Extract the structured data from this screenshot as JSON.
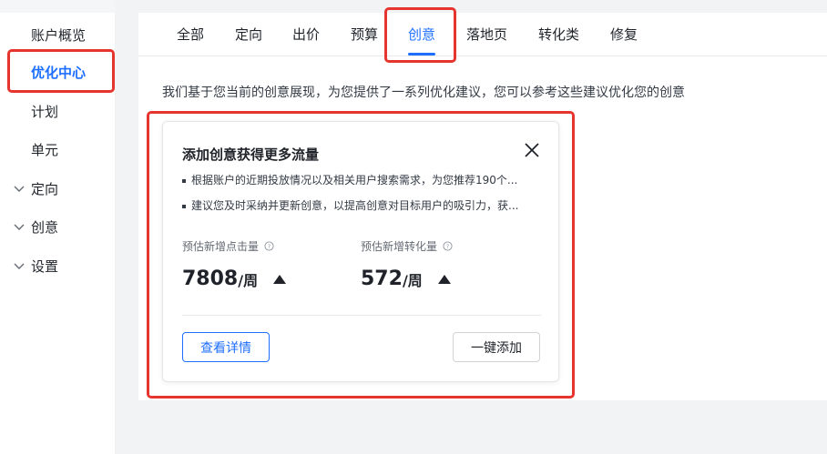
{
  "sidebar": {
    "items": [
      {
        "label": "账户概览"
      },
      {
        "label": "优化中心"
      },
      {
        "label": "计划"
      },
      {
        "label": "单元"
      },
      {
        "label": "定向"
      },
      {
        "label": "创意"
      },
      {
        "label": "设置"
      }
    ],
    "active_item": "优化中心"
  },
  "tabs": [
    {
      "label": "全部"
    },
    {
      "label": "定向"
    },
    {
      "label": "出价"
    },
    {
      "label": "预算"
    },
    {
      "label": "创意"
    },
    {
      "label": "落地页"
    },
    {
      "label": "转化类"
    },
    {
      "label": "修复"
    }
  ],
  "active_tab": "创意",
  "description": "我们基于您当前的创意展现，为您提供了一系列优化建议，您可以参考这些建议优化您的创意",
  "card": {
    "title": "添加创意获得更多流量",
    "bullets": [
      "根据账户的近期投放情况以及相关用户搜索需求，为您推荐190个...",
      "建议您及时采纳并更新创意，以提高创意对目标用户的吸引力，获..."
    ],
    "metrics": [
      {
        "label": "预估新增点击量",
        "value": "7808",
        "unit": "/周",
        "trend_icon": "up-triangle-icon"
      },
      {
        "label": "预估新增转化量",
        "value": "572",
        "unit": "/周",
        "trend_icon": "up-triangle-icon"
      }
    ],
    "detail_button": "查看详情",
    "add_button": "一键添加"
  },
  "colors": {
    "accent": "#1e6fff",
    "highlight_box": "#e5352e",
    "background": "#f2f3f5"
  }
}
